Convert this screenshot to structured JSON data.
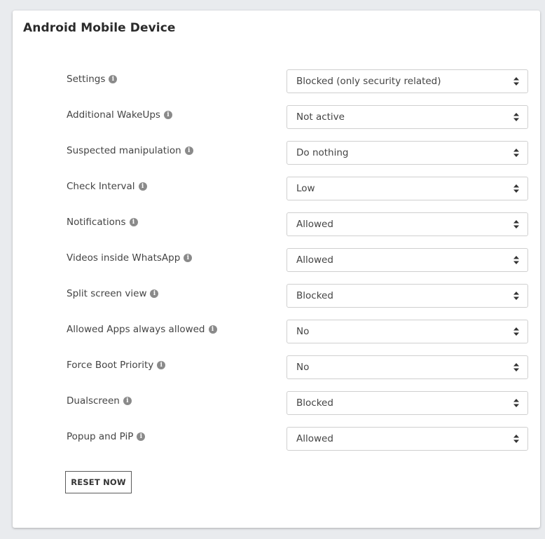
{
  "card": {
    "title": "Android Mobile Device"
  },
  "settings": [
    {
      "label": "Settings",
      "value": "Blocked (only security related)"
    },
    {
      "label": "Additional WakeUps",
      "value": "Not active"
    },
    {
      "label": "Suspected manipulation",
      "value": "Do nothing"
    },
    {
      "label": "Check Interval",
      "value": "Low"
    },
    {
      "label": "Notifications",
      "value": "Allowed"
    },
    {
      "label": "Videos inside WhatsApp",
      "value": "Allowed"
    },
    {
      "label": "Split screen view",
      "value": "Blocked"
    },
    {
      "label": "Allowed Apps always allowed",
      "value": "No"
    },
    {
      "label": "Force Boot Priority",
      "value": "No"
    },
    {
      "label": "Dualscreen",
      "value": "Blocked"
    },
    {
      "label": "Popup and PiP",
      "value": "Allowed"
    }
  ],
  "actions": {
    "reset_label": "RESET NOW"
  },
  "icons": {
    "info": "info-icon",
    "select_arrows": "sort-arrows-icon"
  },
  "colors": {
    "page_background": "#e9ebee",
    "card_background": "#ffffff",
    "info_icon": "#8a8a8a",
    "select_border": "#cfcfcf"
  }
}
